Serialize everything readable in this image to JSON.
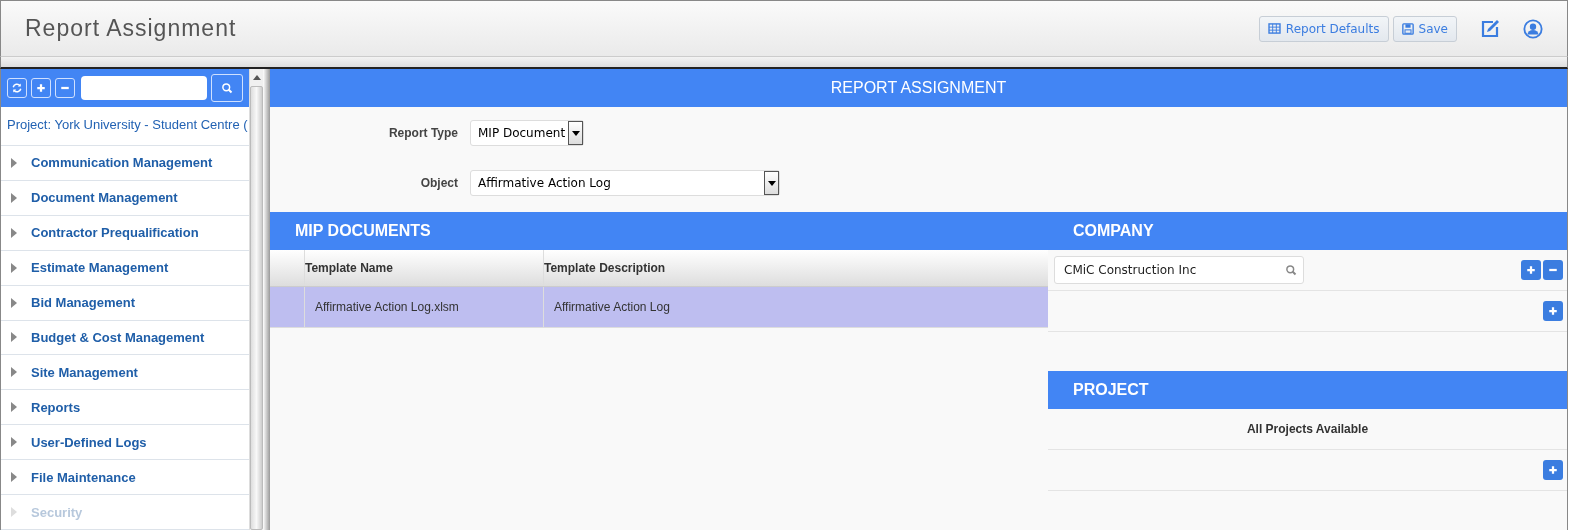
{
  "header": {
    "title": "Report Assignment",
    "buttons": [
      {
        "kind": "table",
        "label": "Report Defaults"
      },
      {
        "kind": "save",
        "label": "Save"
      }
    ]
  },
  "sidebar": {
    "project": "Project: York University - Student Centre (",
    "items": [
      {
        "label": "Communication Management",
        "disabled": false
      },
      {
        "label": "Document Management",
        "disabled": false
      },
      {
        "label": "Contractor Prequalification",
        "disabled": false
      },
      {
        "label": "Estimate Management",
        "disabled": false
      },
      {
        "label": "Bid Management",
        "disabled": false
      },
      {
        "label": "Budget & Cost Management",
        "disabled": false
      },
      {
        "label": "Site Management",
        "disabled": false
      },
      {
        "label": "Reports",
        "disabled": false
      },
      {
        "label": "User-Defined Logs",
        "disabled": false
      },
      {
        "label": "File Maintenance",
        "disabled": false
      },
      {
        "label": "Security",
        "disabled": true
      }
    ]
  },
  "main": {
    "title": "REPORT ASSIGNMENT",
    "fields": [
      {
        "label": "Report Type",
        "value": "MIP Document"
      },
      {
        "label": "Object",
        "value": "Affirmative Action Log"
      }
    ],
    "documents": {
      "title": "MIP DOCUMENTS",
      "columns": [
        "Template Name",
        "Template Description"
      ],
      "rows": [
        {
          "cells": [
            "Affirmative Action Log.xlsm",
            "Affirmative Action Log"
          ],
          "selected": true
        }
      ]
    },
    "company": {
      "title": "COMPANY",
      "value": "CMiC Construction Inc"
    },
    "project": {
      "title": "PROJECT",
      "note": "All Projects Available"
    }
  }
}
